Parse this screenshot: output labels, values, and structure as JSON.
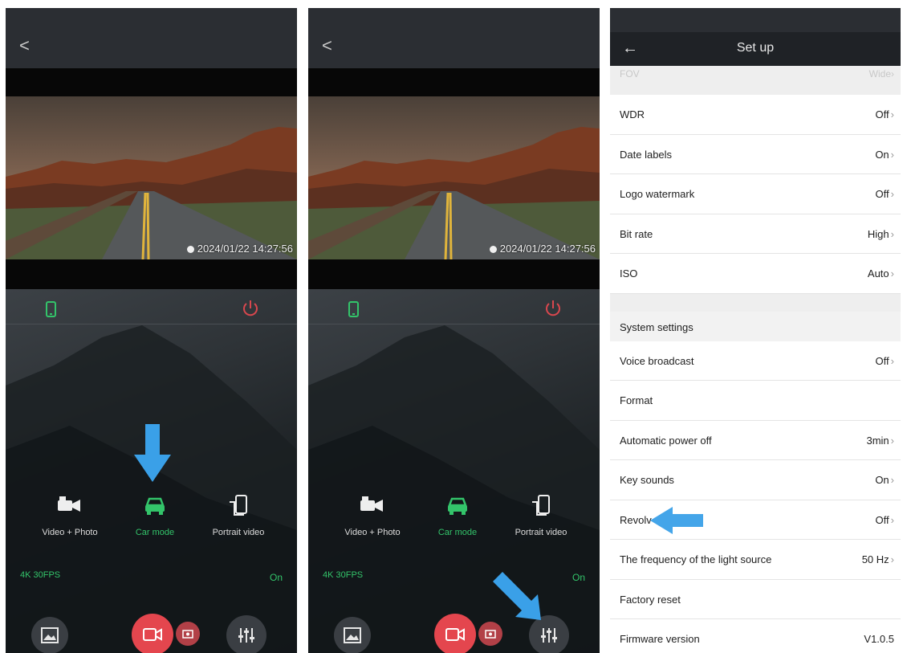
{
  "screens": [
    {
      "back_label": "<",
      "timestamp": "2024/01/22  14:27:56",
      "modes": [
        {
          "label": "Video + Photo",
          "active": false
        },
        {
          "label": "Car mode",
          "active": true
        },
        {
          "label": "Portrait video",
          "active": false
        }
      ],
      "resolution": "4K 30FPS",
      "status": "On"
    },
    {
      "back_label": "<",
      "timestamp": "2024/01/22  14:27:56",
      "modes": [
        {
          "label": "Video + Photo",
          "active": false
        },
        {
          "label": "Car mode",
          "active": true
        },
        {
          "label": "Portrait video",
          "active": false
        }
      ],
      "resolution": "4K 30FPS",
      "status": "On"
    }
  ],
  "setup": {
    "back_label": "←",
    "title": "Set up",
    "fov": {
      "label": "FOV",
      "value": "Wide"
    },
    "items": [
      {
        "label": "WDR",
        "value": "Off"
      },
      {
        "label": "Date labels",
        "value": "On"
      },
      {
        "label": "Logo watermark",
        "value": "Off"
      },
      {
        "label": "Bit rate",
        "value": "High"
      },
      {
        "label": "ISO",
        "value": "Auto"
      }
    ],
    "section_title": "System settings",
    "system_items": [
      {
        "label": "Voice broadcast",
        "value": "Off"
      },
      {
        "label": "Format",
        "value": ""
      },
      {
        "label": "Automatic power off",
        "value": "3min"
      },
      {
        "label": "Key sounds",
        "value": "On"
      },
      {
        "label": "Revolv",
        "value": "Off"
      },
      {
        "label": "The frequency of the light source",
        "value": "50 Hz"
      },
      {
        "label": "Factory reset",
        "value": ""
      },
      {
        "label": "Firmware version",
        "value": "V1.0.5"
      }
    ]
  },
  "colors": {
    "accent_green": "#33c46a",
    "record_red": "#e4464e",
    "arrow_blue": "#3aa0e8"
  }
}
